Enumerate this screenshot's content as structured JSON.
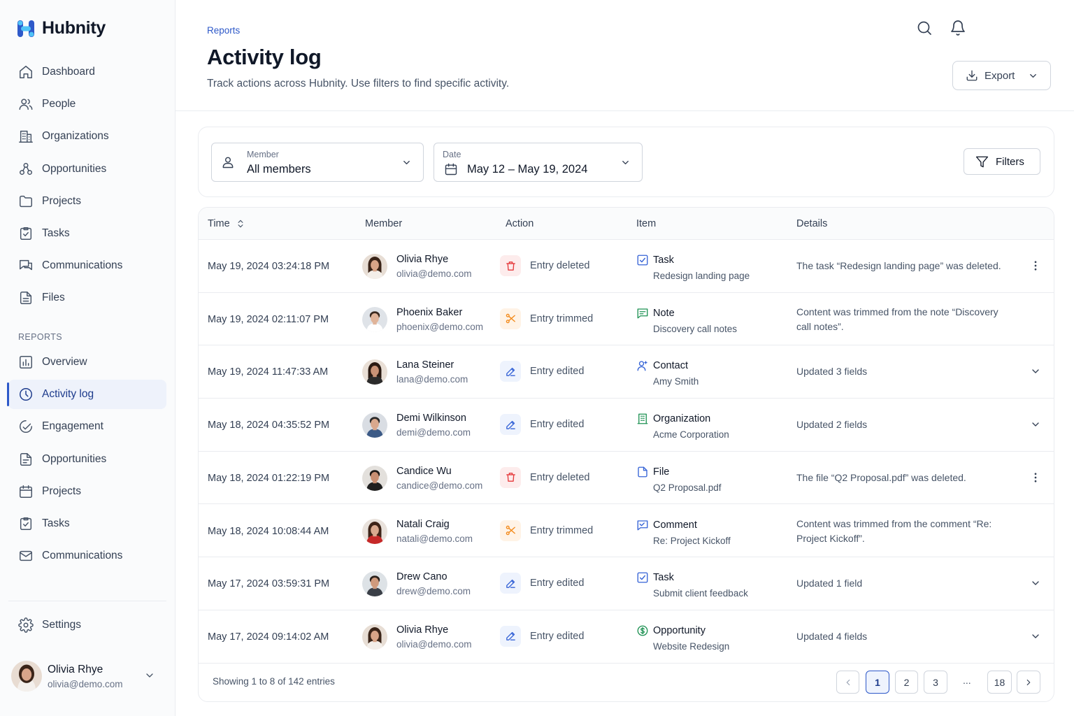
{
  "app": {
    "name": "Hubnity"
  },
  "sidebar": {
    "nav": [
      {
        "label": "Dashboard",
        "icon": "home-icon"
      },
      {
        "label": "People",
        "icon": "users-icon"
      },
      {
        "label": "Organizations",
        "icon": "building-icon"
      },
      {
        "label": "Opportunities",
        "icon": "opportunities-icon"
      },
      {
        "label": "Projects",
        "icon": "folder-icon"
      },
      {
        "label": "Tasks",
        "icon": "clipboard-check-icon"
      },
      {
        "label": "Communications",
        "icon": "chat-icon"
      },
      {
        "label": "Files",
        "icon": "file-icon"
      }
    ],
    "reports_label": "REPORTS",
    "reports": [
      {
        "label": "Overview",
        "icon": "chart-icon"
      },
      {
        "label": "Activity log",
        "icon": "activity-icon",
        "active": true
      },
      {
        "label": "Engagement",
        "icon": "engagement-icon"
      },
      {
        "label": "Opportunities",
        "icon": "document-icon"
      },
      {
        "label": "Projects",
        "icon": "calendar-icon"
      },
      {
        "label": "Tasks",
        "icon": "clipboard-check-icon"
      },
      {
        "label": "Communications",
        "icon": "mail-icon"
      }
    ],
    "settings_label": "Settings",
    "user": {
      "name": "Olivia Rhye",
      "email": "olivia@demo.com"
    }
  },
  "header": {
    "breadcrumb": "Reports",
    "title": "Activity log",
    "subtitle": "Track actions across Hubnity. Use filters to find specific activity.",
    "export_label": "Export"
  },
  "filters": {
    "member_label": "Member",
    "member_value": "All members",
    "date_label": "Date",
    "date_value": "May 12 – May 19, 2024",
    "filters_label": "Filters"
  },
  "table": {
    "columns": [
      "Time",
      "Member",
      "Action",
      "Item",
      "Details"
    ],
    "rows": [
      {
        "time": "May 19, 2024 03:24:18 PM",
        "name": "Olivia Rhye",
        "email": "olivia@demo.com",
        "action": "Entry deleted",
        "action_type": "del",
        "item_type": "Task",
        "item_icon": "task-check-icon",
        "item_name": "Redesign landing page",
        "details": "The task “Redesign landing page” was deleted.",
        "row_action": "more"
      },
      {
        "time": "May 19, 2024 02:11:07 PM",
        "name": "Phoenix Baker",
        "email": "phoenix@demo.com",
        "action": "Entry trimmed",
        "action_type": "trim",
        "item_type": "Note",
        "item_icon": "note-icon",
        "item_name": "Discovery call notes",
        "details": "Content was trimmed from the note “Discovery call notes”.",
        "row_action": ""
      },
      {
        "time": "May 19, 2024 11:47:33 AM",
        "name": "Lana Steiner",
        "email": "lana@demo.com",
        "action": "Entry edited",
        "action_type": "edit",
        "item_type": "Contact",
        "item_icon": "contact-icon",
        "item_name": "Amy Smith",
        "details": "Updated 3 fields",
        "row_action": "expand"
      },
      {
        "time": "May 18, 2024 04:35:52 PM",
        "name": "Demi Wilkinson",
        "email": "demi@demo.com",
        "action": "Entry edited",
        "action_type": "edit",
        "item_type": "Organization",
        "item_icon": "organization-icon",
        "item_name": "Acme Corporation",
        "details": "Updated 2 fields",
        "row_action": "expand"
      },
      {
        "time": "May 18, 2024 01:22:19 PM",
        "name": "Candice Wu",
        "email": "candice@demo.com",
        "action": "Entry deleted",
        "action_type": "del",
        "item_type": "File",
        "item_icon": "file-item-icon",
        "item_name": "Q2 Proposal.pdf",
        "details": "The file “Q2 Proposal.pdf” was deleted.",
        "row_action": "more"
      },
      {
        "time": "May 18, 2024 10:08:44 AM",
        "name": "Natali Craig",
        "email": "natali@demo.com",
        "action": "Entry trimmed",
        "action_type": "trim",
        "item_type": "Comment",
        "item_icon": "comment-icon",
        "item_name": "Re: Project Kickoff",
        "details": "Content was trimmed from the comment “Re: Project Kickoff”.",
        "row_action": ""
      },
      {
        "time": "May 17, 2024 03:59:31 PM",
        "name": "Drew Cano",
        "email": "drew@demo.com",
        "action": "Entry edited",
        "action_type": "edit",
        "item_type": "Task",
        "item_icon": "task-check-icon",
        "item_name": "Submit client feedback",
        "details": "Updated 1 field",
        "row_action": "expand"
      },
      {
        "time": "May 17, 2024 09:14:02 AM",
        "name": "Olivia Rhye",
        "email": "olivia@demo.com",
        "action": "Entry edited",
        "action_type": "edit",
        "item_type": "Opportunity",
        "item_icon": "dollar-icon",
        "item_name": "Website Redesign",
        "details": "Updated 4 fields",
        "row_action": "expand"
      }
    ]
  },
  "pagination": {
    "summary": "Showing 1 to 8 of 142 entries",
    "pages": [
      "1",
      "2",
      "3"
    ],
    "ellipsis": "...",
    "last": "18",
    "current": "1"
  },
  "colors": {
    "accent": "#2e59c9",
    "delete": "#e5393b",
    "trim": "#f38a1a",
    "edit": "#3563d6",
    "item_icon_blue": "#3563d6",
    "item_icon_green": "#1f9254"
  }
}
